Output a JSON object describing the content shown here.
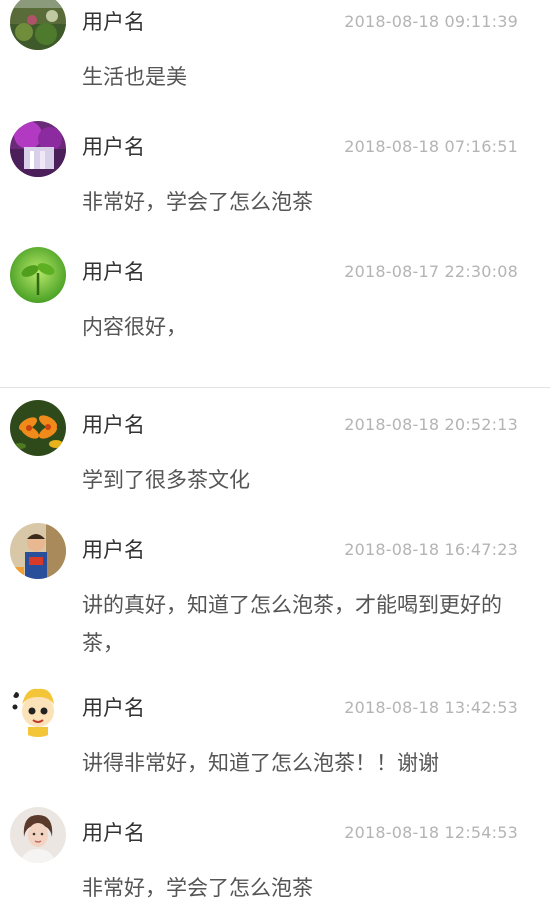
{
  "comments": [
    {
      "username": "用户名",
      "time": "2018-08-18 09:11:39",
      "text": "生活也是美",
      "avatar_icon": "garden-plants-avatar"
    },
    {
      "username": "用户名",
      "time": "2018-08-18 07:16:51",
      "text": "非常好，学会了怎么泡茶",
      "avatar_icon": "purple-waterfall-avatar"
    },
    {
      "username": "用户名",
      "time": "2018-08-17 22:30:08",
      "text": "内容很好，",
      "avatar_icon": "green-sprout-avatar"
    },
    {
      "username": "用户名",
      "time": "2018-08-18 20:52:13",
      "text": "学到了很多茶文化",
      "avatar_icon": "orange-lily-avatar"
    },
    {
      "username": "用户名",
      "time": "2018-08-18 16:47:23",
      "text": "讲的真好，知道了怎么泡茶，才能喝到更好的茶，",
      "avatar_icon": "child-photo-avatar"
    },
    {
      "username": "用户名",
      "time": "2018-08-18 13:42:53",
      "text": "讲得非常好，知道了怎么泡茶！！谢谢",
      "avatar_icon": "cartoon-character-avatar"
    },
    {
      "username": "用户名",
      "time": "2018-08-18 12:54:53",
      "text": "非常好，学会了怎么泡茶",
      "avatar_icon": "woman-portrait-avatar"
    }
  ]
}
